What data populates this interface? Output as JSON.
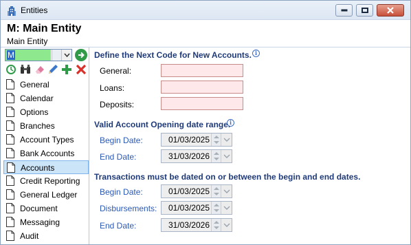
{
  "window": {
    "title": "Entities",
    "minimize_icon": "minimize-icon",
    "maximize_icon": "maximize-icon",
    "close_icon": "close-icon"
  },
  "header": {
    "code_title": "M: Main Entity",
    "sub_title": "Main Entity"
  },
  "sidebar": {
    "combo_value": "M",
    "toolbar": [
      "refresh-icon",
      "binoculars-icon",
      "eraser-icon",
      "pencil-icon",
      "add-icon",
      "delete-icon"
    ],
    "items": [
      {
        "label": "General"
      },
      {
        "label": "Calendar"
      },
      {
        "label": "Options"
      },
      {
        "label": "Branches"
      },
      {
        "label": "Account Types"
      },
      {
        "label": "Bank Accounts"
      },
      {
        "label": "Accounts",
        "selected": true
      },
      {
        "label": "Credit Reporting"
      },
      {
        "label": "General Ledger"
      },
      {
        "label": "Document"
      },
      {
        "label": "Messaging"
      },
      {
        "label": "Audit"
      }
    ]
  },
  "main": {
    "next_code": {
      "title": "Define the Next Code for New Accounts.",
      "general_label": "General:",
      "general_value": "",
      "loans_label": "Loans:",
      "loans_value": "",
      "deposits_label": "Deposits:",
      "deposits_value": ""
    },
    "opening_range": {
      "title": "Valid Account Opening date range.",
      "begin_label": "Begin Date:",
      "begin_value": "01/03/2025",
      "end_label": "End Date:",
      "end_value": "31/03/2026"
    },
    "transactions": {
      "title": "Transactions must be dated on or between the begin and end dates.",
      "begin_label": "Begin Date:",
      "begin_value": "01/03/2025",
      "disb_label": "Disbursements:",
      "disb_value": "01/03/2025",
      "end_label": "End Date:",
      "end_value": "31/03/2026"
    }
  },
  "colors": {
    "section_title": "#1f3a78",
    "field_label_blue": "#2b59b5",
    "input_bg": "#ffe8ea",
    "selected_bg": "#cce4f7",
    "combo_green": "#8ee88e"
  }
}
